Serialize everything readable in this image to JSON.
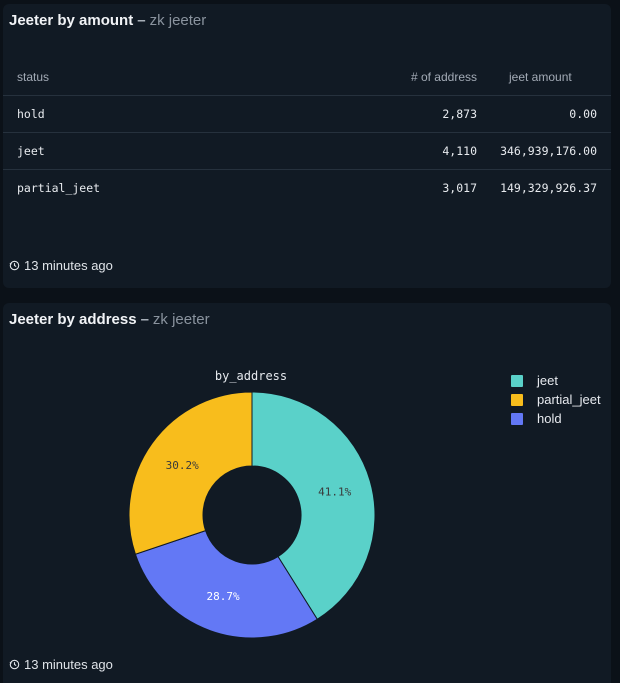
{
  "panel1": {
    "title": "Jeeter by amount",
    "dash": "–",
    "subtitle": "zk jeeter",
    "columns": [
      "status",
      "# of address",
      "jeet amount"
    ],
    "rows": [
      {
        "status": "hold",
        "addresses": "2,873",
        "amount": "0.00"
      },
      {
        "status": "jeet",
        "addresses": "4,110",
        "amount": "346,939,176.00"
      },
      {
        "status": "partial_jeet",
        "addresses": "3,017",
        "amount": "149,329,926.37"
      }
    ],
    "updated": "13 minutes ago"
  },
  "panel2": {
    "title": "Jeeter by address",
    "dash": "–",
    "subtitle": "zk jeeter",
    "updated": "13 minutes ago"
  },
  "chart_data": {
    "type": "pie",
    "title": "by_address",
    "legend_position": "top-right",
    "hole": true,
    "slices": [
      {
        "name": "jeet",
        "value": 4110,
        "label": "41.1%",
        "color": "#5ad1c9"
      },
      {
        "name": "hold",
        "value": 2873,
        "label": "28.7%",
        "color": "#6378f5"
      },
      {
        "name": "partial_jeet",
        "value": 3017,
        "label": "30.2%",
        "color": "#f8bd1c"
      }
    ],
    "legend": [
      {
        "name": "jeet",
        "color": "#5ad1c9"
      },
      {
        "name": "partial_jeet",
        "color": "#f8bd1c"
      },
      {
        "name": "hold",
        "color": "#6378f5"
      }
    ]
  }
}
